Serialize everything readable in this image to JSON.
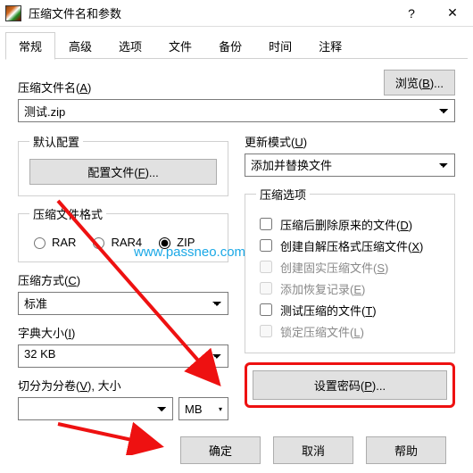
{
  "window": {
    "title": "压缩文件名和参数",
    "help_glyph": "?",
    "close_glyph": "✕"
  },
  "tabs": [
    "常规",
    "高级",
    "选项",
    "文件",
    "备份",
    "时间",
    "注释"
  ],
  "top": {
    "archive_name_label_prefix": "压缩文件名(",
    "archive_name_key": "A",
    "archive_name_label_suffix": ")",
    "archive_name_value": "测试.zip",
    "browse_prefix": "浏览(",
    "browse_key": "B",
    "browse_suffix": ")..."
  },
  "left": {
    "default_profile": "默认配置",
    "profiles_btn_prefix": "配置文件(",
    "profiles_btn_key": "F",
    "profiles_btn_suffix": ")...",
    "format_legend": "压缩文件格式",
    "formats": [
      "RAR",
      "RAR4",
      "ZIP"
    ],
    "method_label_prefix": "压缩方式(",
    "method_label_key": "C",
    "method_label_suffix": ")",
    "method_value": "标准",
    "dict_label_prefix": "字典大小(",
    "dict_label_key": "I",
    "dict_label_suffix": ")",
    "dict_value": "32 KB",
    "split_label_prefix": "切分为分卷(",
    "split_label_key": "V",
    "split_label_suffix": "), 大小",
    "split_unit": "MB"
  },
  "right": {
    "update_label_prefix": "更新模式(",
    "update_label_key": "U",
    "update_label_suffix": ")",
    "update_value": "添加并替换文件",
    "options_legend": "压缩选项",
    "cb": [
      {
        "pre": "压缩后删除原来的文件(",
        "key": "D",
        "suf": ")",
        "disabled": false
      },
      {
        "pre": "创建自解压格式压缩文件(",
        "key": "X",
        "suf": ")",
        "disabled": false
      },
      {
        "pre": "创建固实压缩文件(",
        "key": "S",
        "suf": ")",
        "disabled": true
      },
      {
        "pre": "添加恢复记录(",
        "key": "E",
        "suf": ")",
        "disabled": true
      },
      {
        "pre": "测试压缩的文件(",
        "key": "T",
        "suf": ")",
        "disabled": false
      },
      {
        "pre": "锁定压缩文件(",
        "key": "L",
        "suf": ")",
        "disabled": true
      }
    ],
    "set_pwd_prefix": "设置密码(",
    "set_pwd_key": "P",
    "set_pwd_suffix": ")..."
  },
  "bottom": {
    "ok": "确定",
    "cancel": "取消",
    "help": "帮助"
  },
  "watermark": "www.passneo.com"
}
